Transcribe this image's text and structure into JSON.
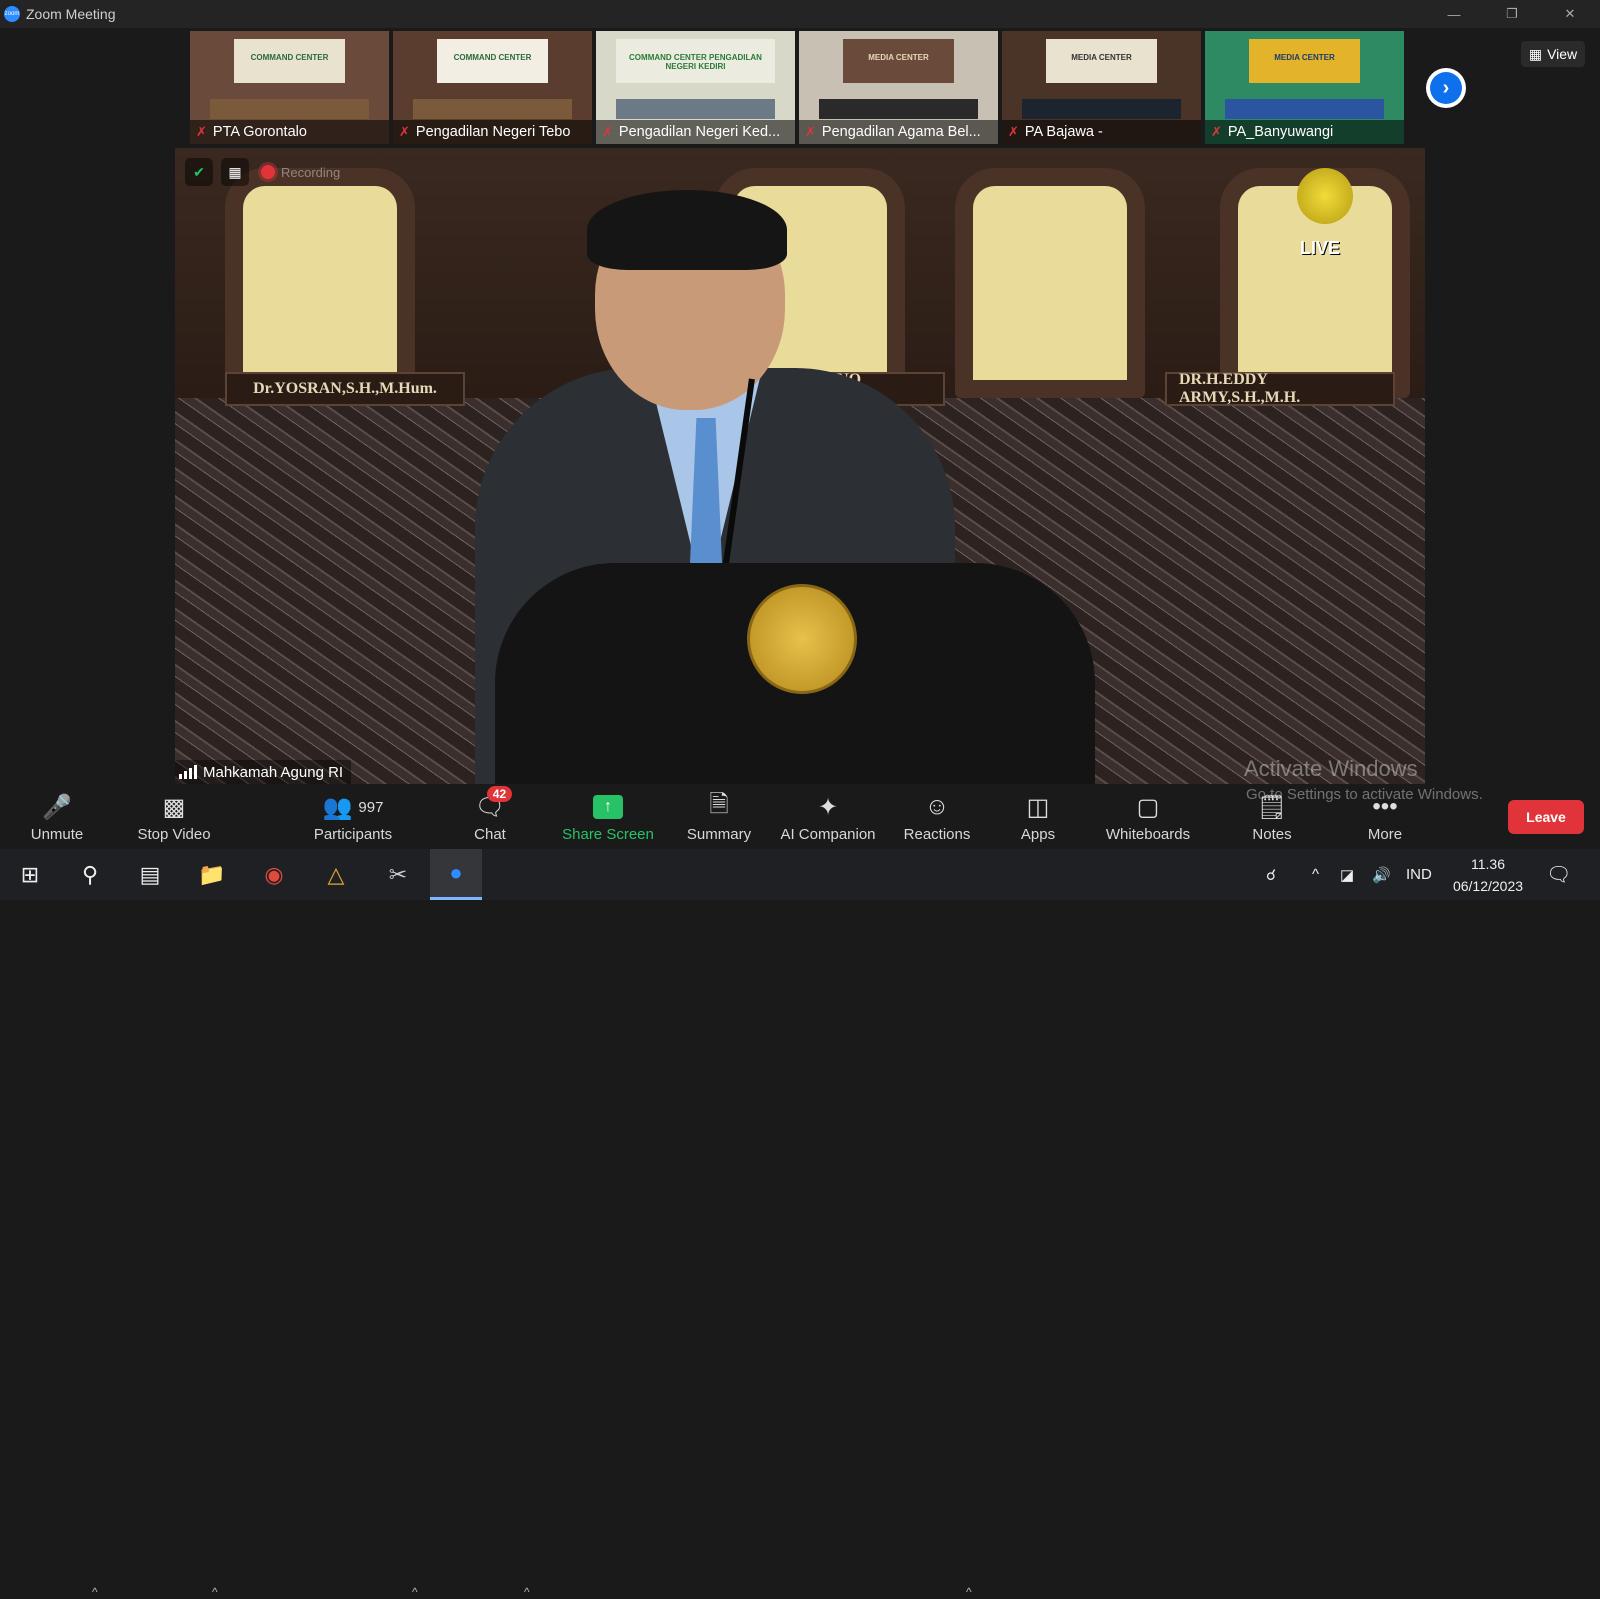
{
  "window": {
    "title": "Zoom Meeting"
  },
  "gallery": {
    "thumbnails": [
      {
        "name": "PTA Gorontalo",
        "banner": "COMMAND CENTER"
      },
      {
        "name": "Pengadilan Negeri Tebo",
        "banner": "COMMAND CENTER"
      },
      {
        "name": "Pengadilan Negeri Ked...",
        "banner": "COMMAND CENTER PENGADILAN NEGERI KEDIRI"
      },
      {
        "name": "Pengadilan Agama Bel...",
        "banner": "MEDIA CENTER"
      },
      {
        "name": "PA Bajawa -",
        "banner": "MEDIA CENTER"
      },
      {
        "name": "PA_Banyuwangi",
        "banner": "MEDIA CENTER"
      }
    ]
  },
  "view_button": {
    "label": "View"
  },
  "main_video": {
    "recording_label": "Recording",
    "live_label": "LIVE",
    "nameplates": [
      "Dr.YOSRAN,S.H.,M.Hum.",
      "DARYONO S.H.,M.H.",
      "DR.H.EDDY ARMY,S.H.,M.H."
    ],
    "speaker_name": "Mahkamah Agung RI"
  },
  "toolbar": {
    "unmute": "Unmute",
    "stop_video": "Stop Video",
    "participants": "Participants",
    "participants_count": "997",
    "chat": "Chat",
    "chat_badge": "42",
    "share_screen": "Share Screen",
    "summary": "Summary",
    "ai_companion": "AI Companion",
    "reactions": "Reactions",
    "apps": "Apps",
    "whiteboards": "Whiteboards",
    "notes": "Notes",
    "more": "More",
    "leave": "Leave"
  },
  "watermark": {
    "line1": "Activate Windows",
    "line2": "Go to Settings to activate Windows."
  },
  "taskbar": {
    "language": "IND",
    "time": "11.36",
    "date": "06/12/2023"
  },
  "colors": {
    "accent_blue": "#0e71eb",
    "share_green": "#27c267",
    "leave_red": "#e0343a"
  }
}
